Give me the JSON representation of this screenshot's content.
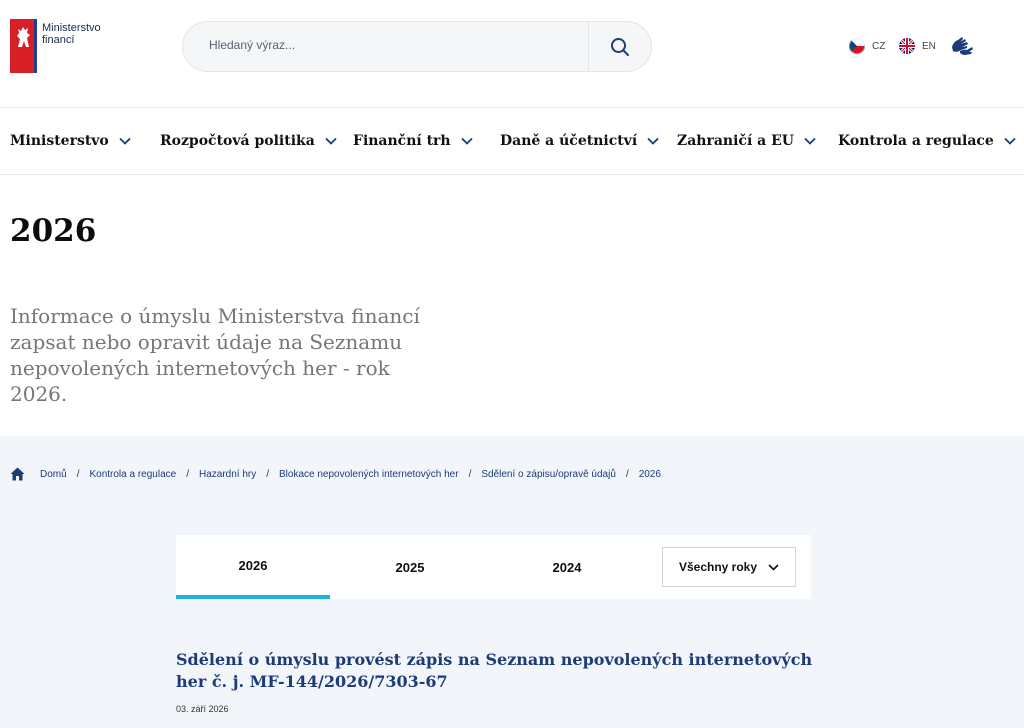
{
  "header": {
    "logo_line1": "Ministerstvo",
    "logo_line2": "financí",
    "search_placeholder": "Hledaný výraz...",
    "languages": [
      {
        "code": "CZ",
        "icon": "czech-flag-icon"
      },
      {
        "code": "EN",
        "icon": "uk-flag-icon"
      }
    ],
    "sign_language_icon": "sign-language-icon"
  },
  "nav": {
    "items": [
      {
        "label": "Ministerstvo"
      },
      {
        "label": "Rozpočtová politika"
      },
      {
        "label": "Finanční trh"
      },
      {
        "label": "Daně a účetnictví"
      },
      {
        "label": "Zahraničí a EU"
      },
      {
        "label": "Kontrola a regulace"
      }
    ]
  },
  "hero": {
    "title": "2026",
    "description": "Informace o úmyslu Ministerstva financí zapsat nebo opravit údaje na Seznamu nepovolených internetových her - rok 2026."
  },
  "breadcrumb": {
    "items": [
      "Domů",
      "Kontrola a regulace",
      "Hazardní hry",
      "Blokace nepovolených internetových her",
      "Sdělení o zápisu/opravě údajů",
      "2026"
    ]
  },
  "tabs": {
    "items": [
      "2026",
      "2025",
      "2024"
    ],
    "active": "2026",
    "select_label": "Všechny roky"
  },
  "article": {
    "title": "Sdělení o úmyslu provést zápis na Seznam nepovolených internetových her č. j. MF-144/2026/7303-67",
    "date": "03. září 2026"
  },
  "colors": {
    "accent": "#1fb1df",
    "link": "#1c3b78",
    "brand_red": "#d81f26",
    "lower_bg": "#f2f6fa"
  }
}
